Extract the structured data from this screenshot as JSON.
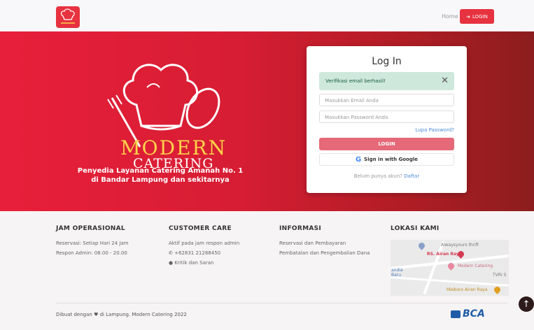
{
  "nav": {
    "home": "Home",
    "login": "LOGIN"
  },
  "hero": {
    "brand_modern": "ODERN",
    "brand_catering": "CATERING",
    "tagline_line1": "Penyedia Layanan Catering Amanah No. 1",
    "tagline_line2": "di Bandar Lampung dan sekitarnya"
  },
  "login": {
    "title": "Log In",
    "alert": "Verifikasi email berhasil!",
    "email_placeholder": "Masukkan Email Anda",
    "password_placeholder": "Masukkan Password Anda",
    "forgot": "Lupa Password?",
    "submit": "LOGIN",
    "google": "Sign in with Google",
    "register_prompt": "Belum punya akun?",
    "register_link": "Daftar"
  },
  "footer": {
    "jam": {
      "title": "JAM OPERASIONAL",
      "items": [
        "Reservasi: Setiap Hari 24 Jam",
        "Respon Admin: 08.00 - 20.00"
      ]
    },
    "care": {
      "title": "CUSTOMER CARE",
      "items": [
        "Aktif pada jam respon admin",
        "+62831 21288450",
        "Kritik dan Saran"
      ]
    },
    "info": {
      "title": "INFORMASI",
      "items": [
        "Reservasi dan Pembayaran",
        "Pembatalan dan Pengembalian Dana"
      ]
    },
    "lokasi": {
      "title": "LOKASI KAMI"
    },
    "map_labels": [
      "Alwaysyours thrift",
      "RS. Airan Raya",
      "Modern Catering",
      "Mieboro Airan Raya",
      "TVRI S",
      "andia",
      "Baru"
    ],
    "credit_prefix": "Dibuat dengan",
    "credit_suffix": "di Lampung. Modern Catering 2022",
    "bank": "BCA"
  },
  "colors": {
    "brand_red": "#e7323f",
    "hero_dark": "#8c1d1e",
    "gold": "#fcd24a",
    "link": "#4b8bd6"
  }
}
